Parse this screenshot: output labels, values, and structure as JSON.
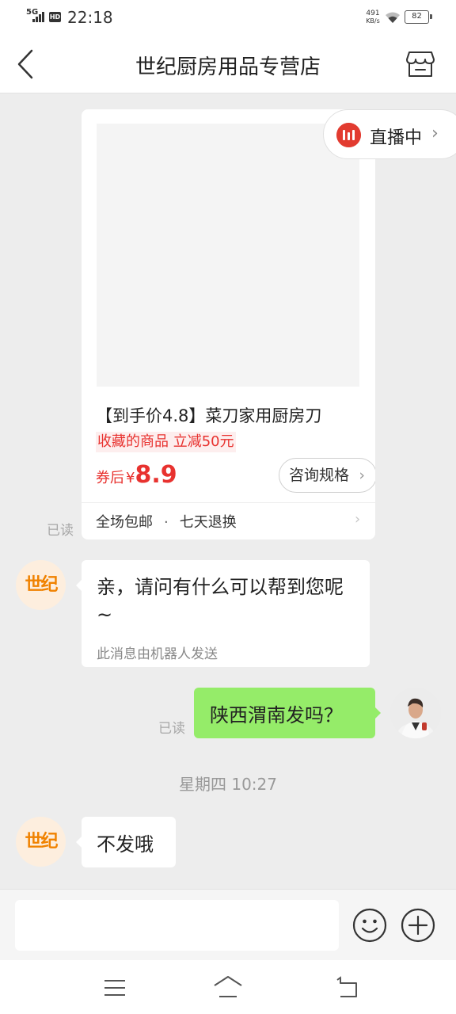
{
  "status_bar": {
    "network": "5G",
    "hd": "HD",
    "time": "22:18",
    "speed_value": "491",
    "speed_unit": "KB/s",
    "battery": "82"
  },
  "header": {
    "title": "世纪厨房用品专营店",
    "back_icon": "chevron-left-icon",
    "shop_icon": "storefront-icon"
  },
  "live": {
    "label": "直播中",
    "chevron": "›",
    "icon": "live-icon"
  },
  "product": {
    "title": "【到手价4.8】菜刀家用厨房刀",
    "promo_tag": "收藏的商品 立减50元",
    "price_prefix": "券后",
    "currency": "¥",
    "price": "8.9",
    "consult_label": "咨询规格",
    "consult_chevron": "›",
    "footer_shipping": "全场包邮",
    "footer_sep": "·",
    "footer_return": "七天退换",
    "footer_chevron": "›"
  },
  "messages": {
    "read_label": "已读",
    "shop_avatar_text": "世纪",
    "bot_reply": "亲，请问有什么可以帮到您呢~",
    "bot_note": "此消息由机器人发送",
    "user_question": "陕西渭南发吗？",
    "timestamp": "星期四  10:27",
    "shop_answer": "不发哦"
  },
  "input": {
    "placeholder": "",
    "value": ""
  },
  "colors": {
    "accent_red": "#e8322f",
    "user_bubble": "#95ec69",
    "shop_orange": "#f08200"
  }
}
